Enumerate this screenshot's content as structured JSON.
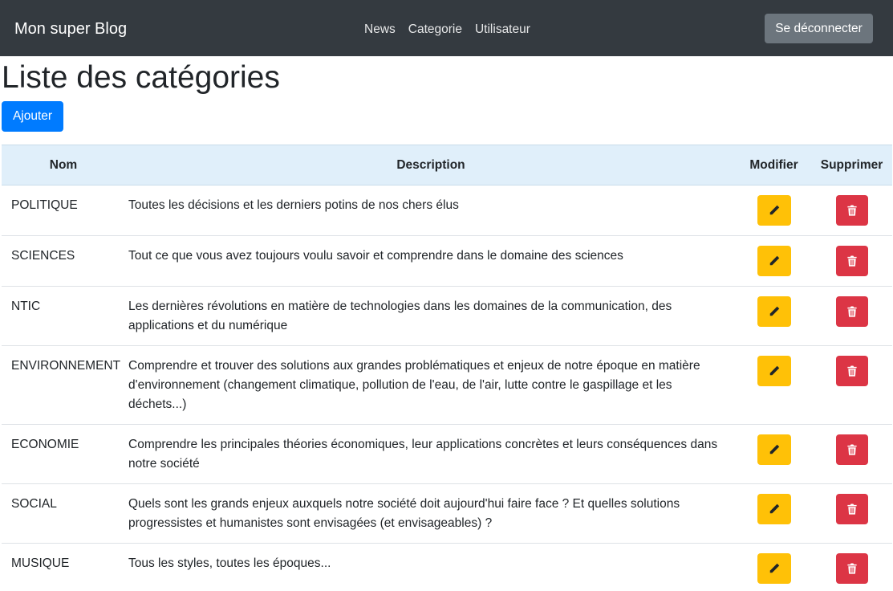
{
  "navbar": {
    "brand": "Mon super Blog",
    "links": [
      "News",
      "Categorie",
      "Utilisateur"
    ],
    "logout_label": "Se déconnecter"
  },
  "page": {
    "title": "Liste des catégories",
    "add_label": "Ajouter"
  },
  "table": {
    "headers": {
      "name": "Nom",
      "description": "Description",
      "edit": "Modifier",
      "delete": "Supprimer"
    },
    "rows": [
      {
        "name": "POLITIQUE",
        "description": "Toutes les décisions et les derniers potins de nos chers élus"
      },
      {
        "name": "SCIENCES",
        "description": "Tout ce que vous avez toujours voulu savoir et comprendre dans le domaine des sciences"
      },
      {
        "name": "NTIC",
        "description": "Les dernières révolutions en matière de technologies dans les domaines de la communication, des applications et du numérique"
      },
      {
        "name": "ENVIRONNEMENT",
        "description": "Comprendre et trouver des solutions aux grandes problématiques et enjeux de notre époque en matière d'environnement (changement climatique, pollution de l'eau, de l'air, lutte contre le gaspillage et les déchets...)"
      },
      {
        "name": "ECONOMIE",
        "description": "Comprendre les principales théories économiques, leur applications concrètes et leurs conséquences dans notre société"
      },
      {
        "name": "SOCIAL",
        "description": "Quels sont les grands enjeux auxquels notre société doit aujourd'hui faire face ? Et quelles solutions progressistes et humanistes sont envisagées (et envisageables) ?"
      },
      {
        "name": "MUSIQUE",
        "description": "Tous les styles, toutes les époques..."
      }
    ]
  },
  "icons": {
    "edit": "pencil-icon",
    "delete": "trash-icon"
  },
  "colors": {
    "navbar": "#343a40",
    "primary": "#007bff",
    "secondary": "#6c757d",
    "warning": "#ffc107",
    "danger": "#dc3545",
    "table_header": "#e0effa"
  }
}
